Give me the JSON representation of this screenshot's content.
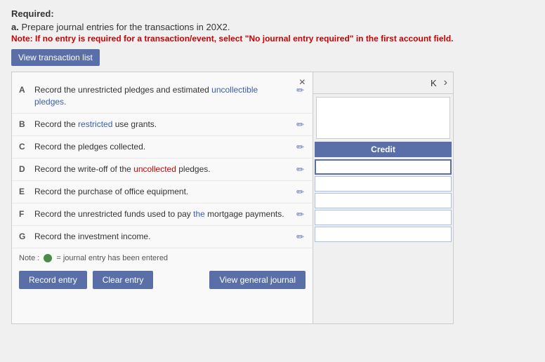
{
  "required_label": "Required:",
  "instruction": {
    "letter": "a.",
    "text": " Prepare journal entries for the transactions in 20X2."
  },
  "note_red": "Note: If no entry is required for a transaction/event, select \"No journal entry required\" in the first account field.",
  "view_transaction_btn": "View transaction list",
  "popup": {
    "close_symbol": "×",
    "transactions": [
      {
        "letter": "A",
        "text_parts": [
          {
            "text": "Record the unrestricted pledges and estimated"
          },
          {
            "text": " uncollectible pledges.",
            "class": "highlight-blue"
          }
        ],
        "full_text": "Record the unrestricted pledges and estimated uncollectible pledges."
      },
      {
        "letter": "B",
        "text_parts": [
          {
            "text": "Record the "
          },
          {
            "text": "restricted",
            "class": "highlight-blue"
          },
          {
            "text": " use grants."
          }
        ],
        "full_text": "Record the restricted use grants."
      },
      {
        "letter": "C",
        "text_parts": [
          {
            "text": "Record the pledges collected."
          }
        ],
        "full_text": "Record the pledges collected."
      },
      {
        "letter": "D",
        "text_parts": [
          {
            "text": "Record the write-off of the "
          },
          {
            "text": "uncollected",
            "class": "highlight-red"
          },
          {
            "text": " pledges."
          }
        ],
        "full_text": "Record the write-off of the uncollected pledges."
      },
      {
        "letter": "E",
        "text_parts": [
          {
            "text": "Record the purchase of office equipment."
          }
        ],
        "full_text": "Record the purchase of office equipment."
      },
      {
        "letter": "F",
        "text_parts": [
          {
            "text": "Record the unrestricted funds used to pay "
          },
          {
            "text": "the",
            "class": "highlight-blue"
          },
          {
            "text": " mortgage payments."
          }
        ],
        "full_text": "Record the unrestricted funds used to pay the mortgage payments."
      },
      {
        "letter": "G",
        "text_parts": [
          {
            "text": "Record the investment income."
          }
        ],
        "full_text": "Record the investment income."
      }
    ],
    "note_text": "Note :",
    "note_journal": "= journal entry has been entered",
    "buttons": {
      "record": "Record entry",
      "clear": "Clear entry",
      "view_journal": "View general journal"
    }
  },
  "journal": {
    "k_label": "K",
    "nav_arrow": "›",
    "credit_label": "Credit",
    "input_rows": 5
  }
}
